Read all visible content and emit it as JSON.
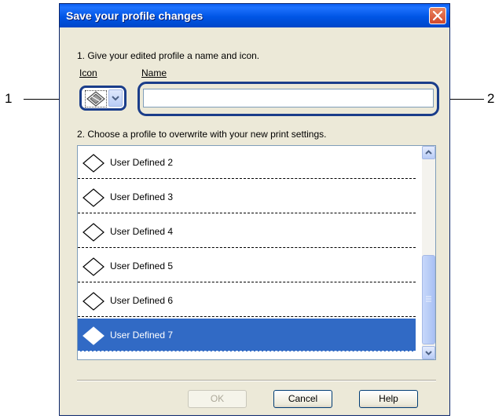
{
  "callouts": {
    "left": "1",
    "right": "2"
  },
  "dialog": {
    "title": "Save your profile changes",
    "step1": "1. Give your edited profile a name and icon.",
    "icon_label": "Icon",
    "name_label": "Name",
    "name_value": "",
    "step2": "2. Choose a profile to overwrite with your new print settings.",
    "profiles": [
      {
        "label": "User Defined 2"
      },
      {
        "label": "User Defined 3"
      },
      {
        "label": "User Defined 4"
      },
      {
        "label": "User Defined 5"
      },
      {
        "label": "User Defined 6"
      },
      {
        "label": "User Defined 7"
      }
    ],
    "selected_profile": "User Defined 7",
    "buttons": {
      "ok": "OK",
      "cancel": "Cancel",
      "help": "Help"
    }
  },
  "colors": {
    "title_bar": "#0055e5",
    "selection": "#316ac5",
    "highlight_border": "#1a3d8a"
  }
}
